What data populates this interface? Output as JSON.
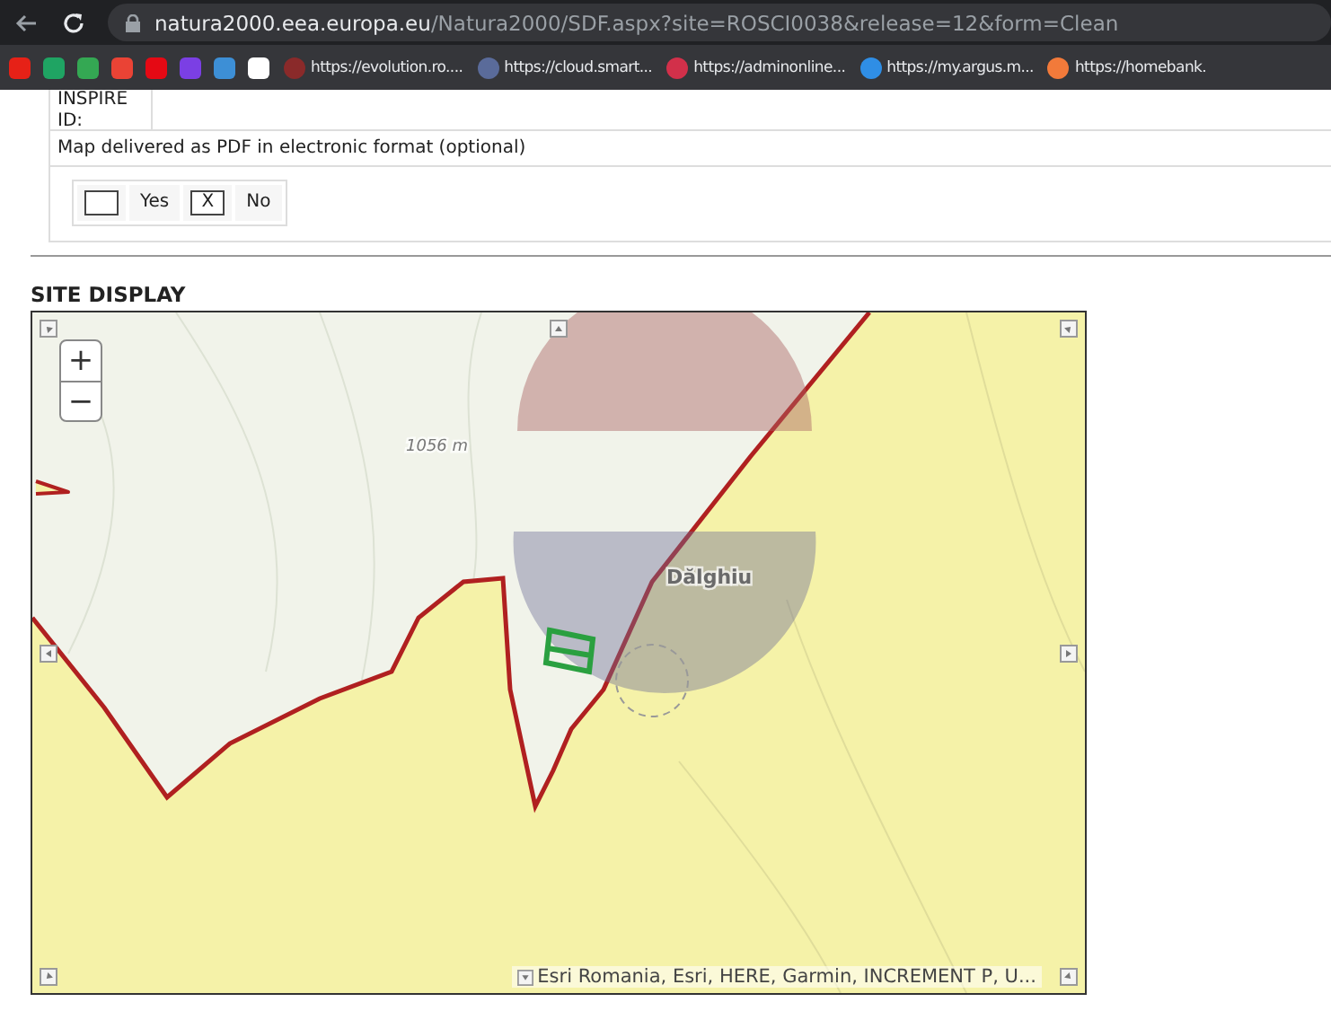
{
  "browser": {
    "url_host": "natura2000.eea.europa.eu",
    "url_path": "/Natura2000/SDF.aspx?site=ROSCI0038&release=12&form=Clean",
    "icon_bookmarks": [
      {
        "color": "#e62117"
      },
      {
        "color": "#1fa463"
      },
      {
        "color": "#34a853"
      },
      {
        "color": "#ea4335"
      },
      {
        "color": "#e50914"
      },
      {
        "color": "#7b3fe4"
      },
      {
        "color": "#3d8fd6"
      },
      {
        "color": "#ffffff"
      }
    ],
    "bookmarks": [
      {
        "label": "https://evolution.ro....",
        "color": "#8a2a2a"
      },
      {
        "label": "https://cloud.smart...",
        "color": "#5a6b9a"
      },
      {
        "label": "https://adminonline...",
        "color": "#d2304a"
      },
      {
        "label": "https://my.argus.m...",
        "color": "#2f8ee5"
      },
      {
        "label": "https://homebank.",
        "color": "#f27a3a"
      }
    ]
  },
  "form": {
    "inspire_id_label": "INSPIRE ID:",
    "map_pdf_label": "Map delivered as PDF in electronic format (optional)",
    "checked_mark": "X",
    "options": [
      {
        "label": "Yes",
        "checked": false
      },
      {
        "label": "No",
        "checked": true
      }
    ]
  },
  "site_display": {
    "title": "SITE DISPLAY",
    "map": {
      "zoom_in": "+",
      "zoom_out": "−",
      "labels": [
        {
          "text": "1056 m",
          "kind": "elevation"
        },
        {
          "text": "Dălghiu",
          "kind": "place"
        }
      ],
      "attribution": "Esri Romania, Esri, HERE, Garmin, INCREMENT P, U..."
    }
  }
}
